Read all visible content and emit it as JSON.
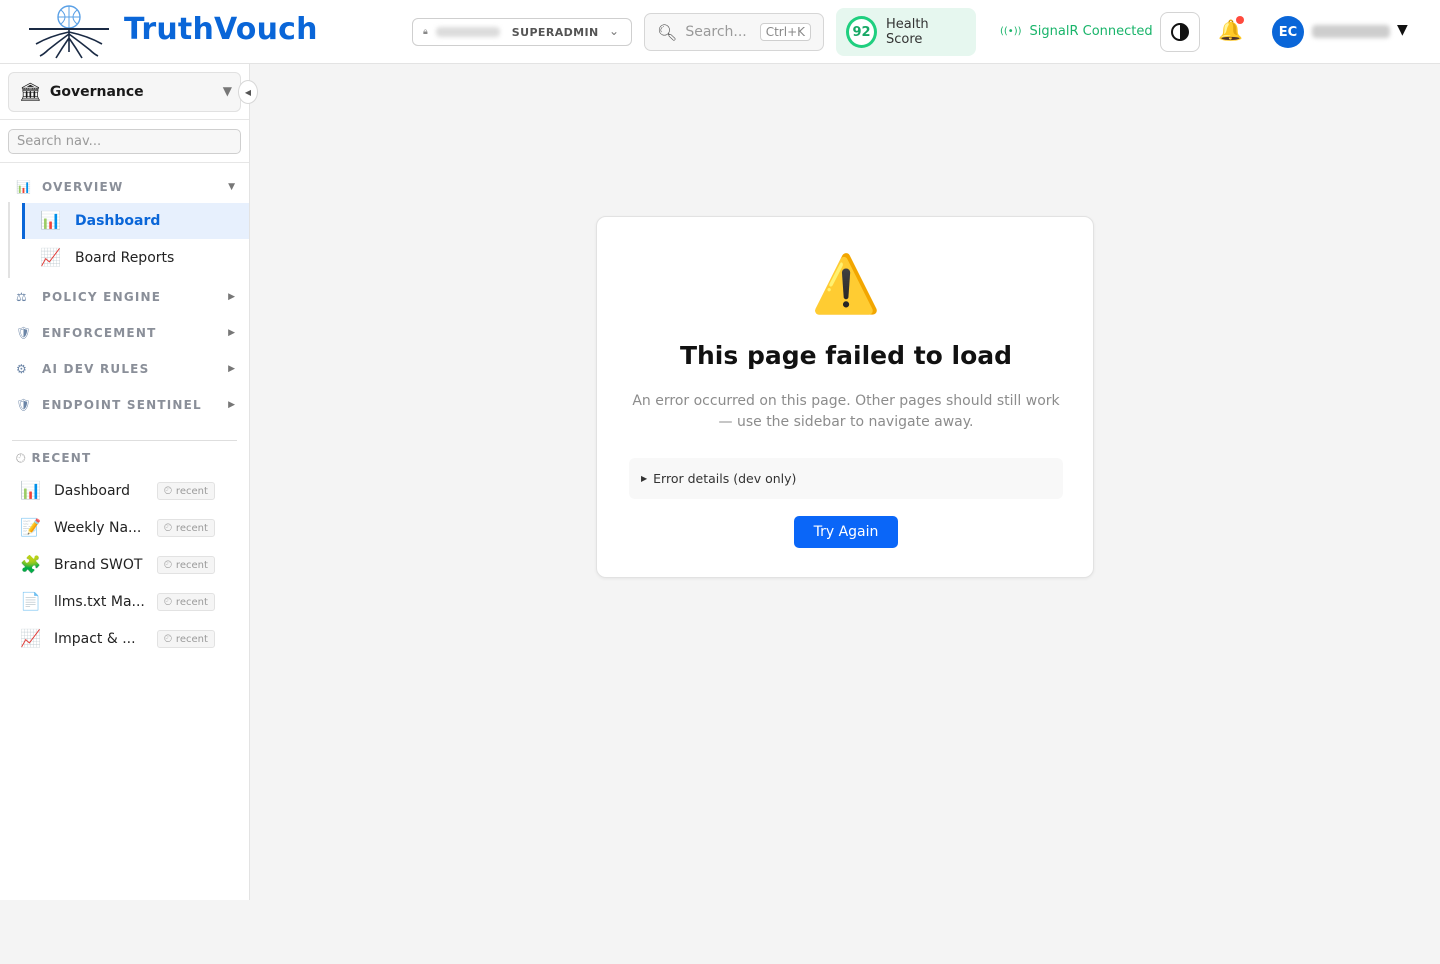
{
  "header": {
    "brand": "TruthVouch",
    "tenant_role": "SUPERADMIN",
    "search_placeholder": "Search...",
    "search_shortcut": "Ctrl+K",
    "health_score": "92",
    "health_label": "Health Score",
    "signal_status": "SignalR Connected",
    "user_initials": "EC"
  },
  "sidebar": {
    "workspace_label": "Governance",
    "nav_search_placeholder": "Search nav...",
    "sections": [
      {
        "label": "OVERVIEW",
        "icon": "bar-chart-icon",
        "expanded": true
      },
      {
        "label": "POLICY ENGINE",
        "icon": "scales-icon",
        "expanded": false
      },
      {
        "label": "ENFORCEMENT",
        "icon": "shield-icon",
        "expanded": false
      },
      {
        "label": "AI DEV RULES",
        "icon": "gear-icon",
        "expanded": false
      },
      {
        "label": "ENDPOINT SENTINEL",
        "icon": "shield-icon",
        "expanded": false
      }
    ],
    "overview_items": [
      {
        "label": "Dashboard",
        "icon": "bar-chart-icon",
        "active": true
      },
      {
        "label": "Board Reports",
        "icon": "line-chart-icon",
        "active": false
      }
    ],
    "recent_heading": "RECENT",
    "recent_badge": "recent",
    "recent_items": [
      {
        "label": "Dashboard",
        "icon": "bar-chart-icon"
      },
      {
        "label": "Weekly Na...",
        "icon": "memo-icon"
      },
      {
        "label": "Brand SWOT",
        "icon": "puzzle-icon"
      },
      {
        "label": "llms.txt Ma...",
        "icon": "document-icon"
      },
      {
        "label": "Impact & ...",
        "icon": "line-chart-icon"
      }
    ]
  },
  "error": {
    "icon": "warning-icon",
    "title": "This page failed to load",
    "description": "An error occurred on this page. Other pages should still work — use the sidebar to navigate away.",
    "details_label": "Error details (dev only)",
    "retry_label": "Try Again"
  },
  "colors": {
    "brand_blue": "#0a66d8",
    "button_blue": "#0a66f8",
    "health_green": "#1fcf7f",
    "signal_green": "#19b46a",
    "active_nav_bg": "#e7f0fd"
  }
}
